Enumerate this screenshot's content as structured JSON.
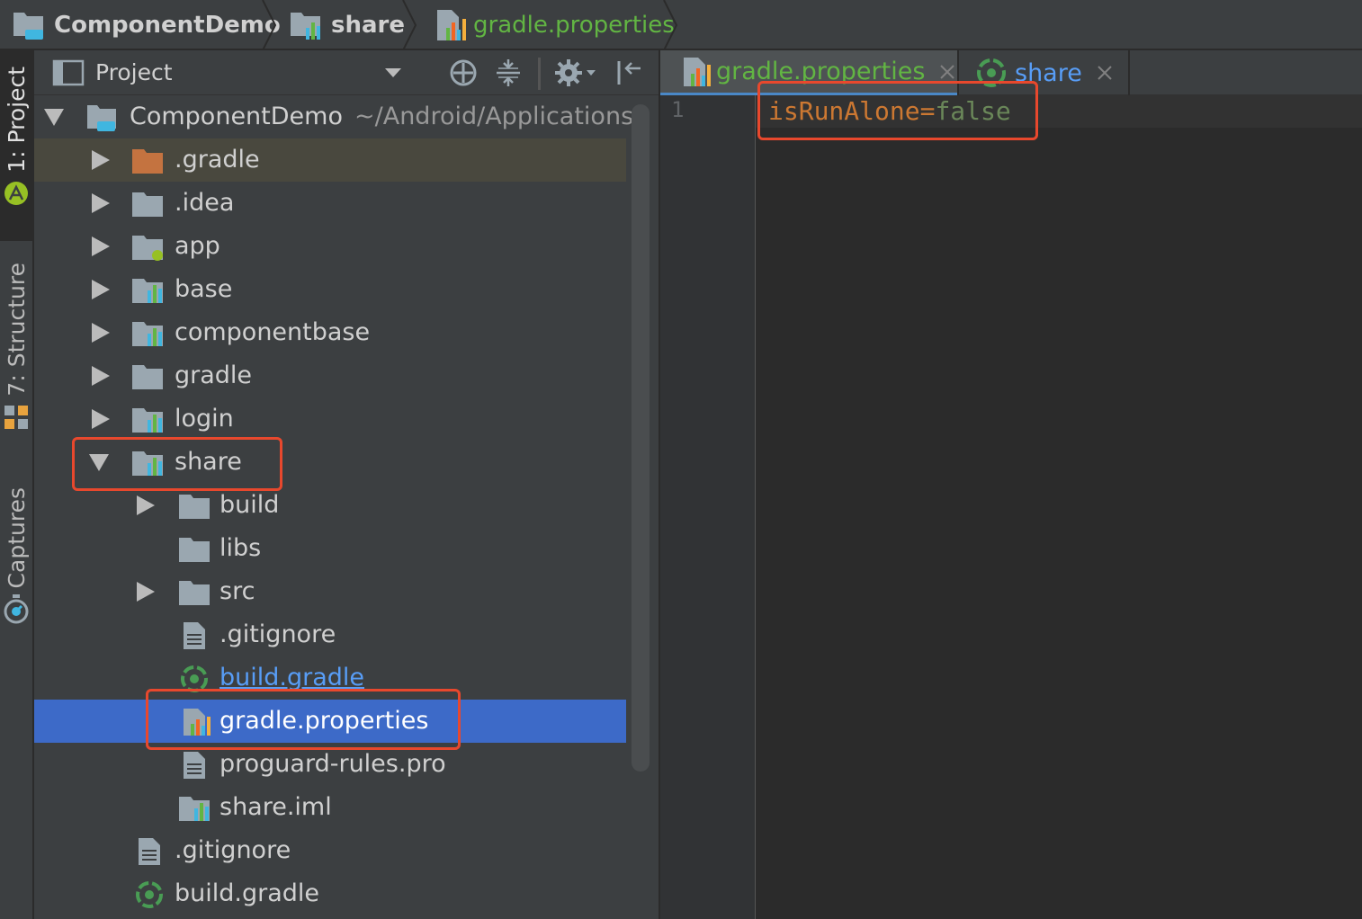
{
  "navbar": {
    "project": "ComponentDemo",
    "module": "share",
    "file": "gradle.properties"
  },
  "tool_strip": {
    "project_tab": "1: Project",
    "structure_tab": "7: Structure",
    "captures_tab": "Captures"
  },
  "project_panel": {
    "view_selector": "Project",
    "root": {
      "name": "ComponentDemo",
      "path": "~/Android/Applications"
    },
    "items": [
      {
        "label": ".gradle",
        "expanded": false
      },
      {
        "label": ".idea",
        "expanded": false
      },
      {
        "label": "app",
        "expanded": false
      },
      {
        "label": "base",
        "expanded": false
      },
      {
        "label": "componentbase",
        "expanded": false
      },
      {
        "label": "gradle",
        "expanded": false
      },
      {
        "label": "login",
        "expanded": false
      },
      {
        "label": "share",
        "expanded": true
      },
      {
        "label": "build",
        "expanded": false
      },
      {
        "label": "libs"
      },
      {
        "label": "src",
        "expanded": false
      },
      {
        "label": ".gitignore"
      },
      {
        "label": "build.gradle"
      },
      {
        "label": "gradle.properties",
        "selected": true
      },
      {
        "label": "proguard-rules.pro"
      },
      {
        "label": "share.iml"
      },
      {
        "label": ".gitignore"
      },
      {
        "label": "build.gradle"
      }
    ]
  },
  "editor": {
    "tabs": [
      {
        "label": "gradle.properties",
        "active": true
      },
      {
        "label": "share",
        "active": false
      }
    ],
    "line_number": "1",
    "code": {
      "key": "isRunAlone",
      "eq": "=",
      "value": "false"
    }
  },
  "colors": {
    "selection": "#3d6ac8",
    "highlight_box": "#e8482d",
    "gradle_green": "#499c54",
    "property_key": "#cc7832",
    "property_value": "#6a8759",
    "excluded_folder": "#c47340",
    "link_blue": "#589df6"
  },
  "icons": [
    "project-module-icon",
    "module-icon",
    "properties-file-icon",
    "folder-icon",
    "gradle-icon",
    "text-file-icon",
    "android-icon",
    "structure-icon",
    "captures-icon",
    "locate-icon",
    "collapse-icon",
    "gear-icon",
    "hide-icon",
    "close-icon"
  ]
}
